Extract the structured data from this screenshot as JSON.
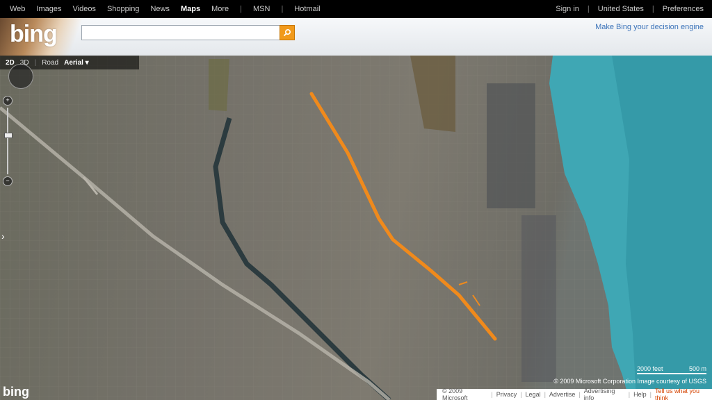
{
  "topnav": {
    "links": [
      "Web",
      "Images",
      "Videos",
      "Shopping",
      "News",
      "Maps",
      "More"
    ],
    "active": "Maps",
    "extra": [
      "MSN",
      "Hotmail"
    ],
    "right": [
      "Sign in",
      "United States",
      "Preferences"
    ]
  },
  "header": {
    "logo": "bing",
    "search_placeholder": "",
    "search_value": "",
    "tagline": "Make Bing your decision engine"
  },
  "map": {
    "mode_2d": "2D",
    "mode_3d": "3D",
    "road": "Road",
    "aerial": "Aerial ▾",
    "scale_feet": "2000 feet",
    "scale_m": "500 m",
    "copyright": "© 2009 Microsoft Corporation   Image courtesy of USGS",
    "bottom_logo": "bing",
    "route_color": "#f08a1c",
    "water_color": "#3fa7b4"
  },
  "footer": {
    "items": [
      "© 2009 Microsoft",
      "Privacy",
      "Legal",
      "Advertise",
      "Advertising info",
      "Help"
    ],
    "feedback": "Tell us what you think"
  }
}
